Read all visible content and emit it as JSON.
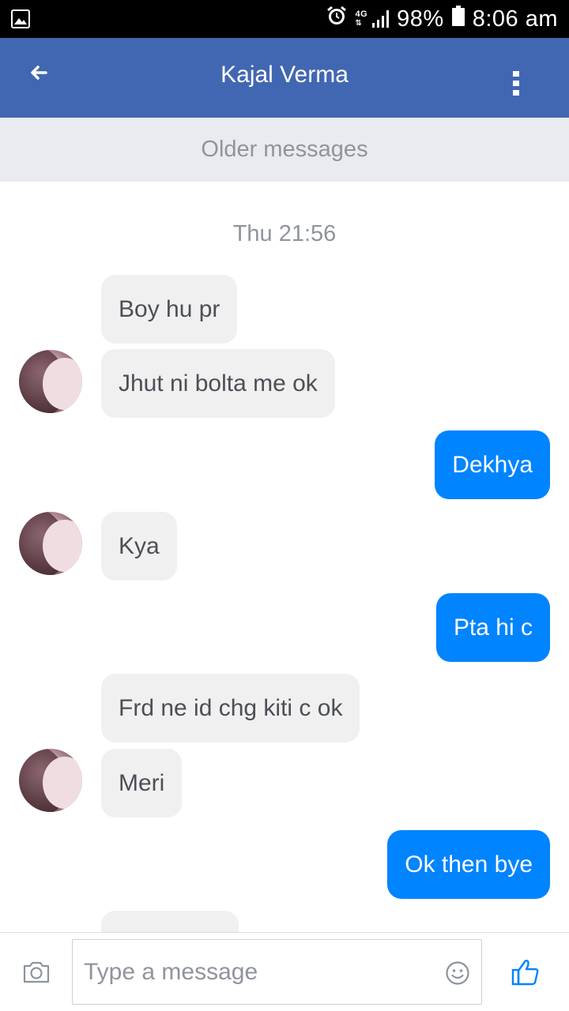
{
  "status_bar": {
    "network": "4G",
    "battery": "98%",
    "time": "8:06 am"
  },
  "header": {
    "title": "Kajal Verma"
  },
  "older_messages_label": "Older messages",
  "timestamp": "Thu 21:56",
  "messages": [
    {
      "from": "them",
      "text": "Boy hu pr"
    },
    {
      "from": "them",
      "text": "Jhut ni bolta me ok"
    },
    {
      "from": "me",
      "text": "Dekhya"
    },
    {
      "from": "them",
      "text": "Kya"
    },
    {
      "from": "me",
      "text": "Pta hi c"
    },
    {
      "from": "them",
      "text": "Frd ne id chg kiti c ok"
    },
    {
      "from": "them",
      "text": "Meri"
    },
    {
      "from": "me",
      "text": "Ok then bye"
    }
  ],
  "composer": {
    "placeholder": "Type a message"
  },
  "colors": {
    "header": "#4267b2",
    "outgoing_bubble": "#0084ff",
    "incoming_bubble": "#f1f0f0"
  },
  "icons": {
    "status_left": "gallery-icon",
    "alarm": "alarm-icon",
    "back": "back-arrow-icon",
    "menu": "more-vert-icon",
    "camera": "camera-icon",
    "emoji": "emoji-icon",
    "like": "thumbs-up-icon"
  }
}
